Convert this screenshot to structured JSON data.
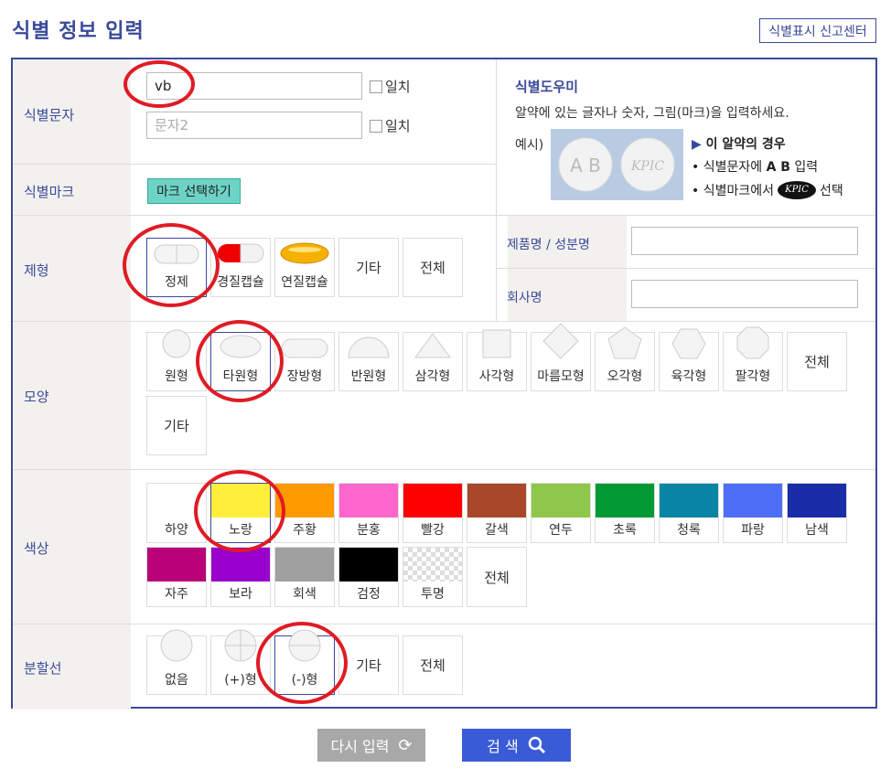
{
  "title": "식별 정보 입력",
  "report_center": "식별표시 신고센터",
  "rows": {
    "ident_chars": "식별문자",
    "ident_mark": "식별마크",
    "form": "제형",
    "shape": "모양",
    "color": "색상",
    "score_line": "분할선"
  },
  "inputs": {
    "char1_value": "vb",
    "char2_placeholder": "문자2",
    "exact_match": "일치"
  },
  "mark_select": "마크 선택하기",
  "helper": {
    "title": "식별도우미",
    "desc": "알약에 있는 글자나 숫자, 그림(마크)을 입력하세요.",
    "example": "예시)",
    "case_title": "이 알약의 경우",
    "line1_prefix": "• 식별문자에",
    "line1_bold": "A B",
    "line1_suffix": "입력",
    "line2_prefix": "• 식별마크에서",
    "line2_suffix": "선택",
    "sample_left": "A B",
    "sample_right": "KPIC"
  },
  "search_fields": {
    "product_label": "제품명 / 성분명",
    "company_label": "회사명",
    "product_value": "",
    "company_value": ""
  },
  "forms": [
    "정제",
    "경질캡슐",
    "연질캡슐",
    "기타",
    "전체"
  ],
  "shapes": [
    "원형",
    "타원형",
    "장방형",
    "반원형",
    "삼각형",
    "사각형",
    "마름모형",
    "오각형",
    "육각형",
    "팔각형",
    "전체",
    "기타"
  ],
  "colors": [
    {
      "name": "하양",
      "hex": "#ffffff"
    },
    {
      "name": "노랑",
      "hex": "#ffee3a"
    },
    {
      "name": "주황",
      "hex": "#ff9900"
    },
    {
      "name": "분홍",
      "hex": "#ff66cc"
    },
    {
      "name": "빨강",
      "hex": "#ff0000"
    },
    {
      "name": "갈색",
      "hex": "#a9472a"
    },
    {
      "name": "연두",
      "hex": "#8fc64c"
    },
    {
      "name": "초록",
      "hex": "#009933"
    },
    {
      "name": "청록",
      "hex": "#0a84a4"
    },
    {
      "name": "파랑",
      "hex": "#4f6ef7"
    },
    {
      "name": "남색",
      "hex": "#1a2da8"
    },
    {
      "name": "자주",
      "hex": "#b80077"
    },
    {
      "name": "보라",
      "hex": "#9900cc"
    },
    {
      "name": "회색",
      "hex": "#a0a0a0"
    },
    {
      "name": "검정",
      "hex": "#000000"
    },
    {
      "name": "투명",
      "hex": "transparent"
    },
    {
      "name": "전체",
      "hex": ""
    }
  ],
  "score_lines": [
    "없음",
    "(+)형",
    "(-)형",
    "기타",
    "전체"
  ],
  "selected": {
    "form": "정제",
    "shape": "타원형",
    "color": "노랑",
    "score_line": "(-)형"
  },
  "buttons": {
    "reset": "다시 입력",
    "search": "검 색"
  },
  "accent": "#3a4a9a",
  "highlight_color": "#e01b24"
}
